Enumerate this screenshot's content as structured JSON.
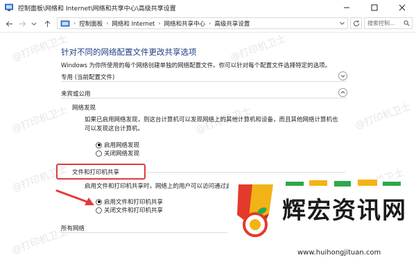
{
  "window": {
    "title": "控制面板\\网络和 Internet\\网络和共享中心\\高级共享设置"
  },
  "addressbar": {
    "breadcrumbs": [
      "控制面板",
      "网络和 Internet",
      "网络和共享中心",
      "高级共享设置"
    ],
    "search_placeholder": "搜索控制..."
  },
  "page": {
    "heading": "针对不同的网络配置文件更改共享选项",
    "description": "Windows 为你所使用的每个网络创建单独的网络配置文件。你可以针对每个配置文件选择特定的选项。"
  },
  "sections": {
    "private": {
      "title": "专用 (当前配置文件)"
    },
    "guest": {
      "title": "来宾或公用"
    },
    "network_discovery": {
      "title": "网络发现",
      "description_line1": "如果已启用网络发现，则这台计算机可以发现网络上的其他计算机和设备，而且其他网络计算机也",
      "description_line2": "可以发现这台计算机。",
      "option_on": "启用网络发现",
      "option_off": "关闭网络发现",
      "selected": "on"
    },
    "file_printer_sharing": {
      "title": "文件和打印机共享",
      "description": "启用文件和打印机共享时，网络上的用户可以访问通过此计算机共享的文件和打印机。",
      "option_on": "启用文件和打印机共享",
      "option_off": "关闭文件和打印机共享",
      "selected": "on"
    },
    "all_networks": {
      "title": "所有网络"
    }
  },
  "watermark": {
    "text": "@打印机卫士"
  },
  "badge": {
    "big_text": "辉宏资讯网",
    "url": "www.huihongjituan.com"
  },
  "colors": {
    "heading": "#1f3f84",
    "highlight_box": "#e23a3a",
    "arrow": "#e23a3a"
  }
}
